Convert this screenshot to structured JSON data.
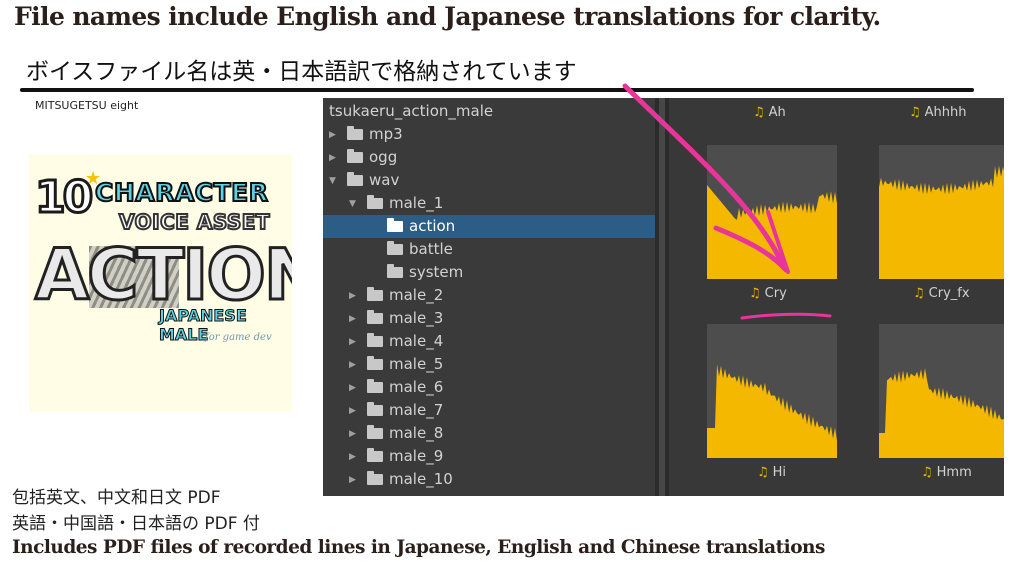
{
  "heading": {
    "english": "File names include English and Japanese translations for clarity.",
    "japanese": "ボイスファイル名は英・日本語訳で格納されています"
  },
  "brand": "MITSUGETSU eight",
  "cover": {
    "number": "10",
    "line1": "CHARACTER",
    "line2": "VOICE ASSET",
    "line3": "ACTION",
    "line4": "JAPANESE MALE",
    "line5": "for game dev"
  },
  "explorer": {
    "root": "tsukaeru_action_male",
    "rows": [
      {
        "label": "mp3",
        "level": 0,
        "expanded": false,
        "selected": false
      },
      {
        "label": "ogg",
        "level": 0,
        "expanded": false,
        "selected": false
      },
      {
        "label": "wav",
        "level": 0,
        "expanded": true,
        "selected": false
      },
      {
        "label": "male_1",
        "level": 1,
        "expanded": true,
        "selected": false
      },
      {
        "label": "action",
        "level": 2,
        "expanded": null,
        "selected": true
      },
      {
        "label": "battle",
        "level": 2,
        "expanded": null,
        "selected": false
      },
      {
        "label": "system",
        "level": 2,
        "expanded": null,
        "selected": false
      },
      {
        "label": "male_2",
        "level": 1,
        "expanded": false,
        "selected": false
      },
      {
        "label": "male_3",
        "level": 1,
        "expanded": false,
        "selected": false
      },
      {
        "label": "male_4",
        "level": 1,
        "expanded": false,
        "selected": false
      },
      {
        "label": "male_5",
        "level": 1,
        "expanded": false,
        "selected": false
      },
      {
        "label": "male_6",
        "level": 1,
        "expanded": false,
        "selected": false
      },
      {
        "label": "male_7",
        "level": 1,
        "expanded": false,
        "selected": false
      },
      {
        "label": "male_8",
        "level": 1,
        "expanded": false,
        "selected": false
      },
      {
        "label": "male_9",
        "level": 1,
        "expanded": false,
        "selected": false
      },
      {
        "label": "male_10",
        "level": 1,
        "expanded": false,
        "selected": false
      }
    ],
    "files_top": [
      "Ah",
      "Ahhhh"
    ],
    "files_mid": [
      "Cry",
      "Cry_fx"
    ],
    "files_bottom": [
      "Hi",
      "Hmm"
    ]
  },
  "footer": {
    "chinese": "包括英文、中文和日文 PDF",
    "japanese": "英語・中国語・日本語の PDF 付",
    "english": "Includes PDF files of recorded lines in Japanese, English and Chinese translations"
  },
  "colors": {
    "accent_arrow": "#e8359a",
    "waveform": "#f5b800",
    "selection": "#2c5d87"
  },
  "icons": [
    "folder-icon",
    "music-note-icon",
    "expand-triangle-icon"
  ]
}
